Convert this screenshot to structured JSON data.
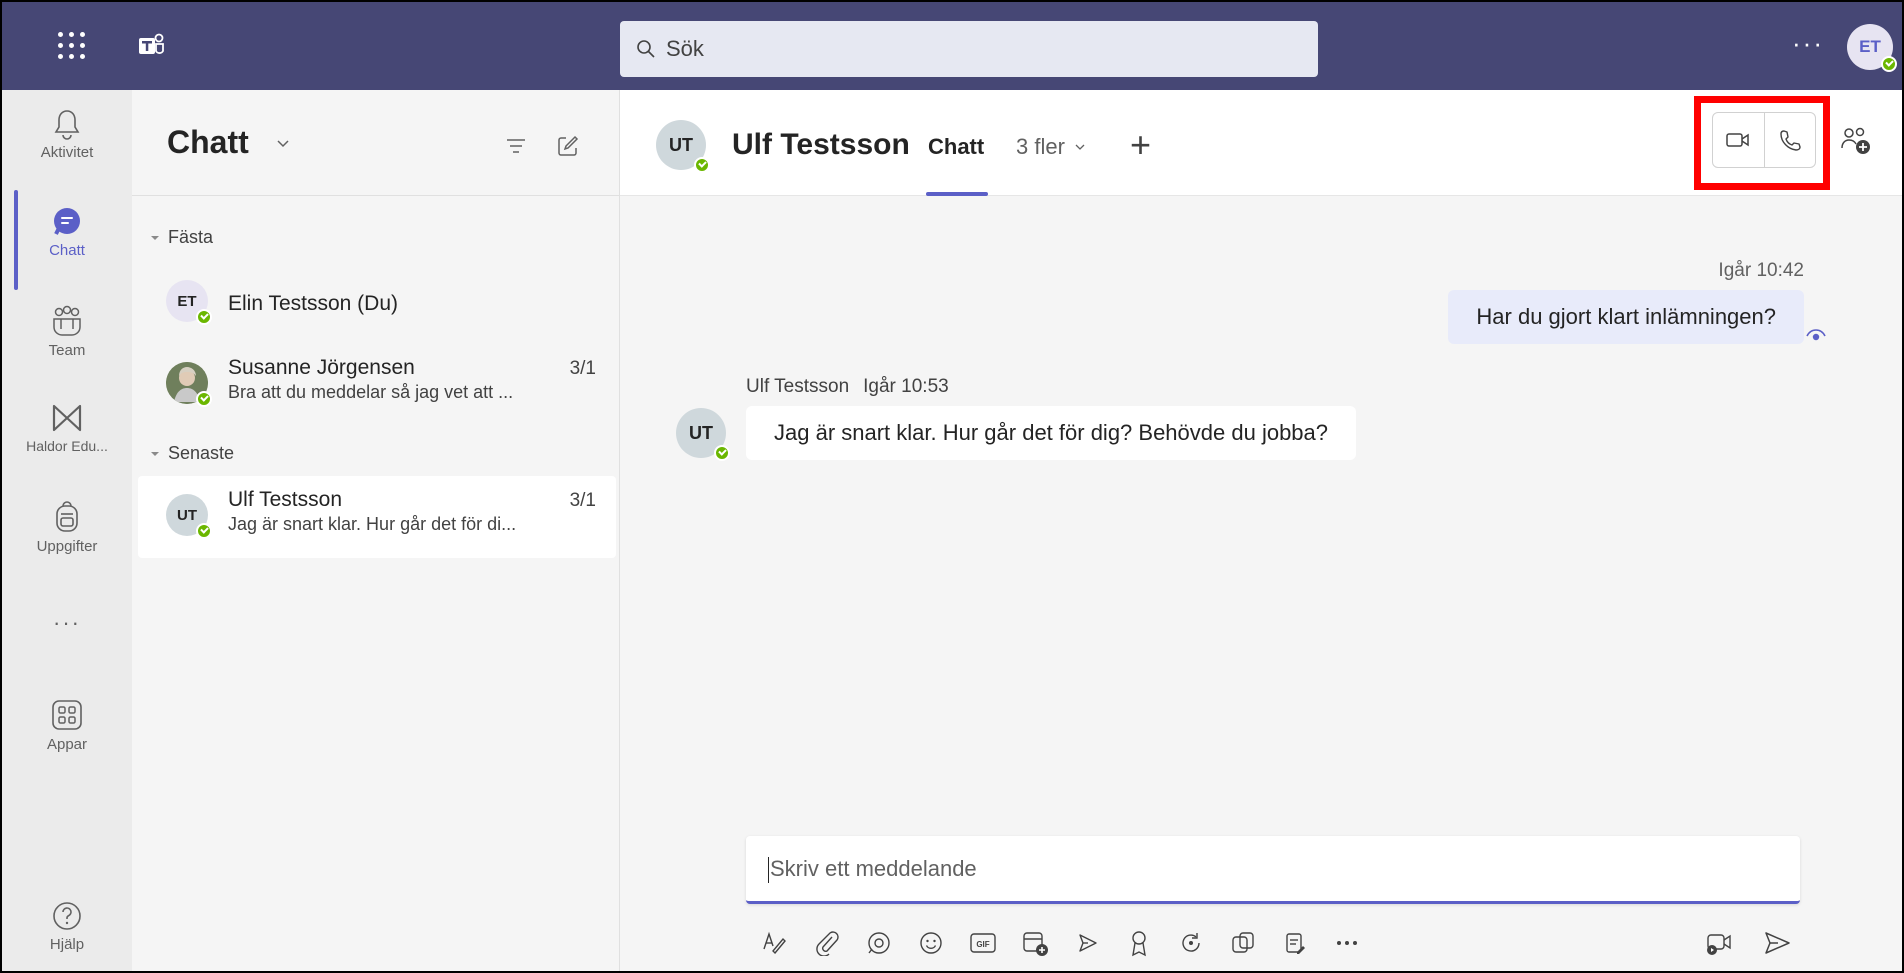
{
  "topbar": {
    "search_placeholder": "Sök",
    "more": "···",
    "user_initials": "ET"
  },
  "rail": {
    "items": [
      {
        "label": "Aktivitet",
        "icon": "bell-icon"
      },
      {
        "label": "Chatt",
        "icon": "chat-icon",
        "active": true
      },
      {
        "label": "Team",
        "icon": "team-icon"
      },
      {
        "label": "Haldor Edu...",
        "icon": "haldor-icon"
      },
      {
        "label": "Uppgifter",
        "icon": "backpack-icon"
      },
      {
        "label": "···",
        "icon": "more-icon"
      },
      {
        "label": "Appar",
        "icon": "apps-icon"
      },
      {
        "label": "Hjälp",
        "icon": "help-icon"
      }
    ]
  },
  "list": {
    "title": "Chatt",
    "sections": {
      "pinned": "Fästa",
      "recent": "Senaste"
    },
    "chats": [
      {
        "initials": "ET",
        "name": "Elin Testsson (Du)",
        "date": "",
        "preview": ""
      },
      {
        "initials": "",
        "name": "Susanne Jörgensen",
        "date": "3/1",
        "preview": "Bra att du meddelar så jag vet att ..."
      },
      {
        "initials": "UT",
        "name": "Ulf Testsson",
        "date": "3/1",
        "preview": "Jag är snart klar. Hur går det för di..."
      }
    ]
  },
  "chat": {
    "initials": "UT",
    "name": "Ulf Testsson",
    "tab": "Chatt",
    "more_tabs": "3 fler",
    "plus": "+",
    "messages": [
      {
        "sender": "me",
        "time": "Igår 10:42",
        "text": "Har du gjort klart inlämningen?"
      },
      {
        "sender": "Ulf Testsson",
        "time": "Igår 10:53",
        "text": "Jag är snart klar. Hur går det för dig? Behövde du jobba?"
      }
    ],
    "composer_placeholder": "Skriv ett meddelande"
  },
  "colors": {
    "topbar": "#464775",
    "accent": "#5b5fc7",
    "highlight": "#ff0000",
    "presence": "#6bb700"
  }
}
